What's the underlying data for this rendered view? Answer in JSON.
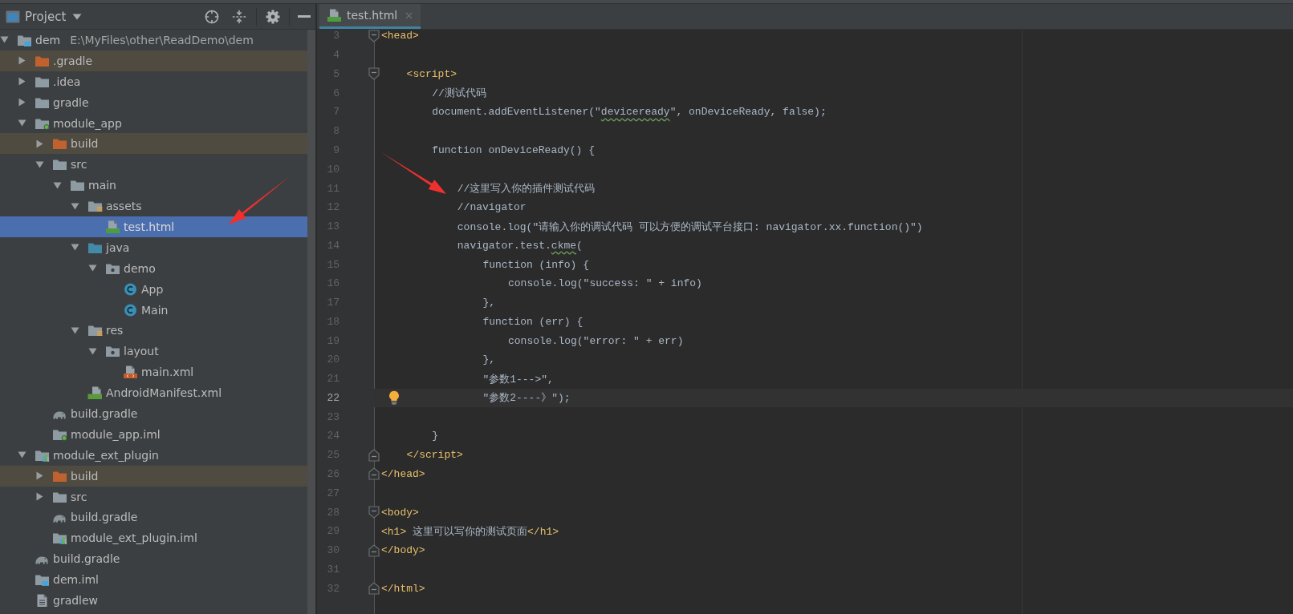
{
  "project_panel": {
    "title": "Project",
    "tree": [
      {
        "label": "dem",
        "path": "E:\\MyFiles\\other\\ReadDemo\\dem",
        "kind": "module_root",
        "expanded": true,
        "selected": false,
        "children": [
          {
            "label": ".gradle",
            "kind": "folder_excluded",
            "expanded": false,
            "selected": false
          },
          {
            "label": ".idea",
            "kind": "folder",
            "expanded": false,
            "selected": false
          },
          {
            "label": "gradle",
            "kind": "folder",
            "expanded": false,
            "selected": false
          },
          {
            "label": "module_app",
            "kind": "module_app",
            "expanded": true,
            "selected": false,
            "children": [
              {
                "label": "build",
                "kind": "folder_excluded",
                "expanded": false,
                "selected": false
              },
              {
                "label": "src",
                "kind": "folder",
                "expanded": true,
                "selected": false,
                "children": [
                  {
                    "label": "main",
                    "kind": "folder",
                    "expanded": true,
                    "selected": false,
                    "children": [
                      {
                        "label": "assets",
                        "kind": "resources",
                        "expanded": true,
                        "selected": false,
                        "children": [
                          {
                            "label": "test.html",
                            "kind": "html",
                            "selected": true
                          }
                        ]
                      },
                      {
                        "label": "java",
                        "kind": "source_root",
                        "expanded": true,
                        "selected": false,
                        "children": [
                          {
                            "label": "demo",
                            "kind": "package",
                            "expanded": true,
                            "selected": false,
                            "children": [
                              {
                                "label": "App",
                                "kind": "class",
                                "selected": false
                              },
                              {
                                "label": "Main",
                                "kind": "class",
                                "selected": false
                              }
                            ]
                          }
                        ]
                      },
                      {
                        "label": "res",
                        "kind": "resources",
                        "expanded": true,
                        "selected": false,
                        "children": [
                          {
                            "label": "layout",
                            "kind": "package",
                            "expanded": true,
                            "selected": false,
                            "children": [
                              {
                                "label": "main.xml",
                                "kind": "xml",
                                "selected": false
                              }
                            ]
                          }
                        ]
                      },
                      {
                        "label": "AndroidManifest.xml",
                        "kind": "manifest",
                        "selected": false
                      }
                    ]
                  }
                ]
              },
              {
                "label": "build.gradle",
                "kind": "gradle",
                "selected": false
              },
              {
                "label": "module_app.iml",
                "kind": "module_app",
                "selected": false
              }
            ]
          },
          {
            "label": "module_ext_plugin",
            "kind": "module_lib",
            "expanded": true,
            "selected": false,
            "children": [
              {
                "label": "build",
                "kind": "folder_excluded",
                "expanded": false,
                "selected": false
              },
              {
                "label": "src",
                "kind": "folder",
                "expanded": false,
                "selected": false
              },
              {
                "label": "build.gradle",
                "kind": "gradle",
                "selected": false
              },
              {
                "label": "module_ext_plugin.iml",
                "kind": "module_lib",
                "selected": false
              }
            ]
          },
          {
            "label": "build.gradle",
            "kind": "gradle",
            "selected": false
          },
          {
            "label": "dem.iml",
            "kind": "module_root",
            "selected": false
          },
          {
            "label": "gradlew",
            "kind": "text_file",
            "selected": false
          }
        ]
      }
    ]
  },
  "editor": {
    "tabs": [
      {
        "label": "test.html",
        "kind": "html",
        "selected": true
      }
    ],
    "lines": [
      {
        "number": "3",
        "fold_start": true,
        "current": false,
        "tokens": [
          {
            "kind": "tag",
            "text": "<head>"
          }
        ],
        "children": [
          {
            "number": "4",
            "current": false
          },
          {
            "number": "5",
            "fold_start": true,
            "current": false,
            "tokens": [
              {
                "kind": "tag",
                "text": "<script>"
              }
            ],
            "children": [
              {
                "number": "6",
                "current": false,
                "tokens": [
                  {
                    "kind": "plain",
                    "text": "//测试代码"
                  }
                ]
              },
              {
                "number": "7",
                "current": false,
                "tokens": [
                  {
                    "kind": "plain",
                    "text": "document.addEventListener(\""
                  },
                  {
                    "kind": "typo",
                    "text": "deviceready"
                  },
                  {
                    "kind": "plain",
                    "text": "\", onDeviceReady, false);"
                  }
                ]
              },
              {
                "number": "8",
                "current": false
              },
              {
                "number": "9",
                "current": false,
                "tokens": [
                  {
                    "kind": "plain",
                    "text": "function onDeviceReady() {"
                  }
                ],
                "children": [
                  {
                    "number": "10",
                    "current": false
                  },
                  {
                    "number": "11",
                    "current": false,
                    "tokens": [
                      {
                        "kind": "plain",
                        "text": "//这里写入你的插件测试代码"
                      }
                    ]
                  },
                  {
                    "number": "12",
                    "current": false,
                    "tokens": [
                      {
                        "kind": "plain",
                        "text": "//navigator"
                      }
                    ]
                  },
                  {
                    "number": "13",
                    "current": false,
                    "tokens": [
                      {
                        "kind": "plain",
                        "text": "console.log(\"请输入你的调试代码 可以方便的调试平台接口: navigator.xx.function()\")"
                      }
                    ]
                  },
                  {
                    "number": "14",
                    "current": false,
                    "tokens": [
                      {
                        "kind": "plain",
                        "text": "navigator.test."
                      },
                      {
                        "kind": "typo",
                        "text": "ckme"
                      },
                      {
                        "kind": "plain",
                        "text": "("
                      }
                    ],
                    "children": [
                      {
                        "number": "15",
                        "current": false,
                        "tokens": [
                          {
                            "kind": "plain",
                            "text": "function (info) {"
                          }
                        ],
                        "children": [
                          {
                            "number": "16",
                            "current": false,
                            "tokens": [
                              {
                                "kind": "plain",
                                "text": "console.log(\"success: \" + info)"
                              }
                            ]
                          }
                        ]
                      },
                      {
                        "number": "17",
                        "current": false,
                        "tokens": [
                          {
                            "kind": "plain",
                            "text": "},"
                          }
                        ]
                      },
                      {
                        "number": "18",
                        "current": false,
                        "tokens": [
                          {
                            "kind": "plain",
                            "text": "function (err) {"
                          }
                        ],
                        "children": [
                          {
                            "number": "19",
                            "current": false,
                            "tokens": [
                              {
                                "kind": "plain",
                                "text": "console.log(\"error: \" + err)"
                              }
                            ]
                          }
                        ]
                      },
                      {
                        "number": "20",
                        "current": false,
                        "tokens": [
                          {
                            "kind": "plain",
                            "text": "},"
                          }
                        ]
                      },
                      {
                        "number": "21",
                        "current": false,
                        "tokens": [
                          {
                            "kind": "plain",
                            "text": "\"参数1--->\","
                          }
                        ]
                      },
                      {
                        "number": "22",
                        "current": true,
                        "bulb": true,
                        "tokens": [
                          {
                            "kind": "plain",
                            "text": "\"参数2----》\");"
                          }
                        ]
                      }
                    ]
                  },
                  {
                    "number": "23",
                    "current": false
                  }
                ]
              },
              {
                "number": "24",
                "current": false,
                "tokens": [
                  {
                    "kind": "plain",
                    "text": "}"
                  }
                ]
              }
            ]
          },
          {
            "number": "25",
            "fold_end": true,
            "current": false,
            "tokens": [
              {
                "kind": "tag",
                "text": "</script>"
              }
            ]
          }
        ]
      },
      {
        "number": "26",
        "fold_end": true,
        "current": false,
        "tokens": [
          {
            "kind": "tag",
            "text": "</head>"
          }
        ]
      },
      {
        "number": "27",
        "current": false
      },
      {
        "number": "28",
        "fold_start": true,
        "current": false,
        "tokens": [
          {
            "kind": "tag",
            "text": "<body>"
          }
        ]
      },
      {
        "number": "29",
        "current": false,
        "tokens": [
          {
            "kind": "tag",
            "text": "<h1>"
          },
          {
            "kind": "plain",
            "text": " 这里可以写你的测试页面"
          },
          {
            "kind": "tag",
            "text": "</h1>"
          }
        ]
      },
      {
        "number": "30",
        "fold_end": true,
        "current": false,
        "tokens": [
          {
            "kind": "tag",
            "text": "</body>"
          }
        ]
      },
      {
        "number": "31",
        "current": false
      },
      {
        "number": "32",
        "fold_end": true,
        "current": false,
        "tokens": [
          {
            "kind": "tag",
            "text": "</html>"
          }
        ]
      }
    ]
  }
}
